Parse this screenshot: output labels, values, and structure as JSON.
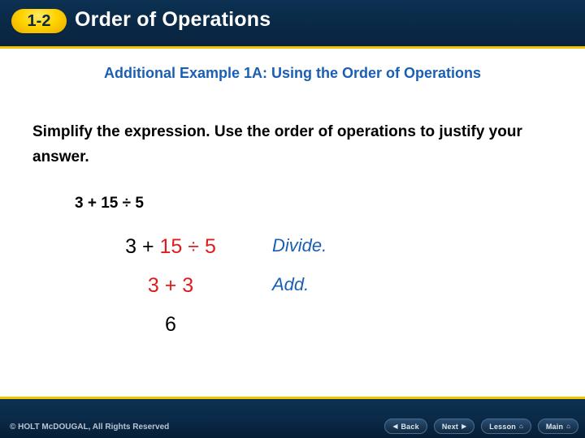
{
  "header": {
    "lesson_number": "1-2",
    "title": "Order of Operations",
    "badge_color": "#ffd400",
    "bar_color": "#0a2a48",
    "accent_color": "#f5c400"
  },
  "body": {
    "example_title": "Additional Example 1A: Using the Order of Operations",
    "prompt": "Simplify the expression. Use the order of operations to justify your answer.",
    "expression": "3 + 15 ÷ 5",
    "accent_color": "#1a5fb4",
    "highlight_color": "#e01b1b",
    "steps": [
      {
        "lead": "3 + ",
        "highlight": "15 ÷ 5",
        "trail": "",
        "note": "Divide."
      },
      {
        "lead": "",
        "highlight": "3 + 3",
        "trail": "",
        "note": "Add."
      },
      {
        "lead": "",
        "highlight": "",
        "trail": "6",
        "note": ""
      }
    ]
  },
  "footer": {
    "copyright": "© HOLT McDOUGAL, All Rights Reserved",
    "nav_buttons": [
      {
        "label": "Back",
        "icon": "chevron-left-icon",
        "glyph": "◀"
      },
      {
        "label": "Next",
        "icon": "chevron-right-icon",
        "glyph": "▶"
      },
      {
        "label": "Lesson",
        "icon": "home-icon",
        "glyph": "⌂"
      },
      {
        "label": "Main",
        "icon": "home-icon",
        "glyph": "⌂"
      }
    ]
  }
}
